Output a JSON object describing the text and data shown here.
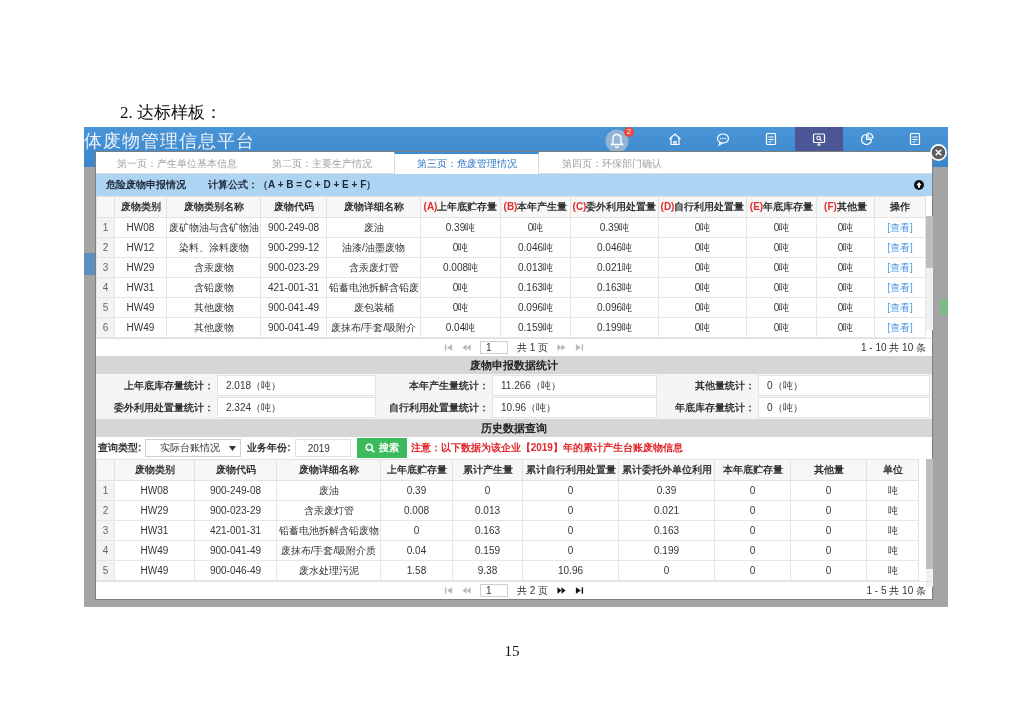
{
  "document": {
    "heading": "2. 达标样板：",
    "page_number": "15"
  },
  "app": {
    "title": "体废物管理信息平台",
    "notification_count": "2",
    "nav": [
      {
        "kind": "home",
        "selected": false
      },
      {
        "kind": "chat",
        "selected": false
      },
      {
        "kind": "document",
        "selected": false
      },
      {
        "kind": "monitor",
        "selected": true
      },
      {
        "kind": "chart",
        "selected": false
      },
      {
        "kind": "document",
        "selected": false
      }
    ]
  },
  "modal": {
    "tabs": [
      {
        "label": "第一页：产生单位基本信息",
        "selected": false
      },
      {
        "label": "第二页：主要生产情况",
        "selected": false
      },
      {
        "label": "第三页：危废管理情况",
        "selected": true
      },
      {
        "label": "第四页：环保部门确认",
        "selected": false
      }
    ],
    "declaration": {
      "title": "危险废物申报情况",
      "formula": "计算公式：（A + B = C + D + E + F）",
      "columns": [
        {
          "label": "废物类别"
        },
        {
          "label": "废物类别名称"
        },
        {
          "label": "废物代码"
        },
        {
          "label": "废物详细名称"
        },
        {
          "prefix": "(A)",
          "label": "上年底贮存量"
        },
        {
          "prefix": "(B)",
          "label": "本年产生量"
        },
        {
          "prefix": "(C)",
          "label": "委外利用处置量"
        },
        {
          "prefix": "(D)",
          "label": "自行利用处置量"
        },
        {
          "prefix": "(E)",
          "label": "年底库存量"
        },
        {
          "prefix": "(F)",
          "label": "其他量"
        },
        {
          "label": "操作"
        }
      ],
      "rows": [
        {
          "number": "1",
          "cells": [
            "HW08",
            "废矿物油与含矿物油",
            "900-249-08",
            "废油",
            "0.39吨",
            "0吨",
            "0.39吨",
            "0吨",
            "0吨",
            "0吨"
          ],
          "action": "[查看]"
        },
        {
          "number": "2",
          "cells": [
            "HW12",
            "染料、涂料废物",
            "900-299-12",
            "油漆/油墨废物",
            "0吨",
            "0.046吨",
            "0.046吨",
            "0吨",
            "0吨",
            "0吨"
          ],
          "action": "[查看]"
        },
        {
          "number": "3",
          "cells": [
            "HW29",
            "含汞废物",
            "900-023-29",
            "含汞废灯管",
            "0.008吨",
            "0.013吨",
            "0.021吨",
            "0吨",
            "0吨",
            "0吨"
          ],
          "action": "[查看]"
        },
        {
          "number": "4",
          "cells": [
            "HW31",
            "含铅废物",
            "421-001-31",
            "铅蓄电池拆解含铅废",
            "0吨",
            "0.163吨",
            "0.163吨",
            "0吨",
            "0吨",
            "0吨"
          ],
          "action": "[查看]"
        },
        {
          "number": "5",
          "cells": [
            "HW49",
            "其他废物",
            "900-041-49",
            "废包装桶",
            "0吨",
            "0.096吨",
            "0.096吨",
            "0吨",
            "0吨",
            "0吨"
          ],
          "action": "[查看]"
        },
        {
          "number": "6",
          "cells": [
            "HW49",
            "其他废物",
            "900-041-49",
            "废抹布/手套/吸附介",
            "0.04吨",
            "0.159吨",
            "0.199吨",
            "0吨",
            "0吨",
            "0吨"
          ],
          "action": "[查看]"
        }
      ],
      "pager": {
        "page": "1",
        "pages": "共 1 页",
        "summary": "1 - 10 共 10 条",
        "buttons": [
          {
            "kind": "first",
            "disabled": true
          },
          {
            "kind": "previous",
            "disabled": true
          },
          {
            "kind": "next",
            "disabled": true
          },
          {
            "kind": "last",
            "disabled": true
          }
        ]
      }
    },
    "statistics": {
      "title": "废物申报数据统计",
      "items": [
        {
          "label": "上年底库存量统计：",
          "value": "2.018（吨）"
        },
        {
          "label": "本年产生量统计：",
          "value": "11.266（吨）"
        },
        {
          "label": "其他量统计：",
          "value": "0（吨）"
        },
        {
          "label": "委外利用处置量统计：",
          "value": "2.324（吨）"
        },
        {
          "label": "自行利用处置量统计：",
          "value": "10.96（吨）"
        },
        {
          "label": "年底库存量统计：",
          "value": "0（吨）"
        }
      ]
    },
    "history": {
      "title": "历史数据查询",
      "query": {
        "type_label": "查询类型:",
        "type_value": "实际台账情况",
        "year_label": "业务年份:",
        "year_value": "2019",
        "button": "搜索",
        "notice": "注意：以下数据为该企业【2019】年的累计产生台账废物信息"
      },
      "columns": [
        "废物类别",
        "废物代码",
        "废物详细名称",
        "上年底贮存量",
        "累计产生量",
        "累计自行利用处置量",
        "累计委托外单位利用",
        "本年底贮存量",
        "其他量",
        "单位"
      ],
      "rows": [
        {
          "number": "1",
          "cells": [
            "HW08",
            "900-249-08",
            "废油",
            "0.39",
            "0",
            "0",
            "0.39",
            "0",
            "0",
            "吨"
          ]
        },
        {
          "number": "2",
          "cells": [
            "HW29",
            "900-023-29",
            "含汞废灯管",
            "0.008",
            "0.013",
            "0",
            "0.021",
            "0",
            "0",
            "吨"
          ]
        },
        {
          "number": "3",
          "cells": [
            "HW31",
            "421-001-31",
            "铅蓄电池拆解含铅废物",
            "0",
            "0.163",
            "0",
            "0.163",
            "0",
            "0",
            "吨"
          ]
        },
        {
          "number": "4",
          "cells": [
            "HW49",
            "900-041-49",
            "废抹布/手套/吸附介质",
            "0.04",
            "0.159",
            "0",
            "0.199",
            "0",
            "0",
            "吨"
          ]
        },
        {
          "number": "5",
          "cells": [
            "HW49",
            "900-046-49",
            "废水处理污泥",
            "1.58",
            "9.38",
            "10.96",
            "0",
            "0",
            "0",
            "吨"
          ]
        }
      ],
      "pager": {
        "page": "1",
        "pages": "共 2 页",
        "summary": "1 - 5 共 10 条",
        "buttons": [
          {
            "kind": "first",
            "disabled": true
          },
          {
            "kind": "previous",
            "disabled": true
          },
          {
            "kind": "next",
            "disabled": false
          },
          {
            "kind": "last",
            "disabled": false
          }
        ]
      }
    }
  }
}
